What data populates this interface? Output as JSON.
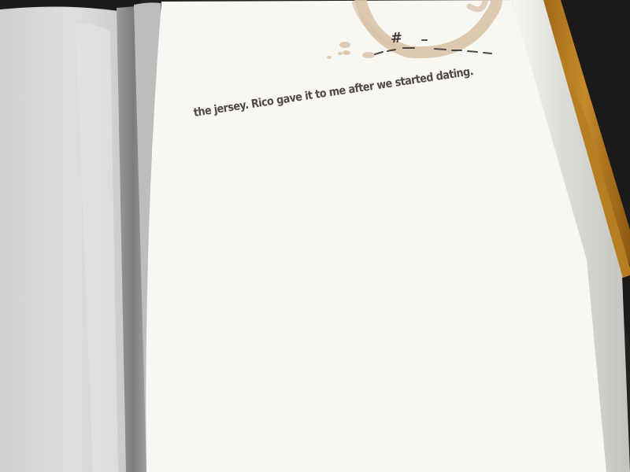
{
  "journal": {
    "text_line": "the jersey. Rico gave it to me after we started dating.",
    "page_number_label": "#",
    "page_number_value": ""
  },
  "colors": {
    "paper": "#f8f7f2",
    "left_page": "#dcdcdb",
    "spine_shadow": "#8f8f8d",
    "cover_edge": "#b57a1f",
    "background": "#232120",
    "coffee_stain": "#d9c3a9",
    "ink": "#4e4a47"
  }
}
